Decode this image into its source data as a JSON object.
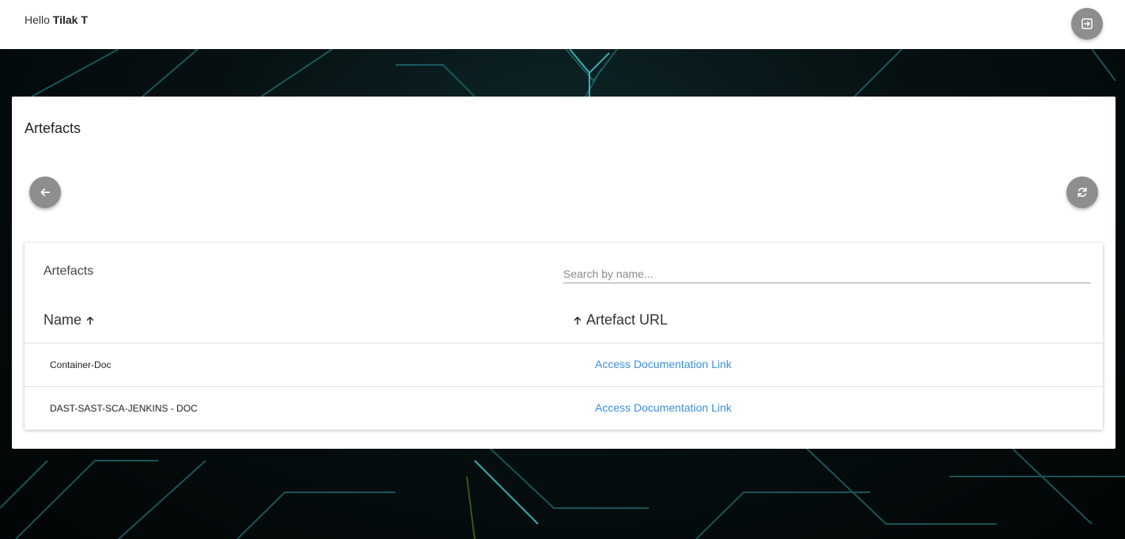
{
  "header": {
    "greeting_prefix": "Hello",
    "user_name": "Tilak T",
    "logout_icon": "logout-icon"
  },
  "main": {
    "title": "Artefacts",
    "back_icon": "arrow-left-icon",
    "refresh_icon": "refresh-icon"
  },
  "table": {
    "title": "Artefacts",
    "search_placeholder": "Search by name...",
    "columns": [
      {
        "label": "Name",
        "sort": "ascending"
      },
      {
        "label": "Artefact URL",
        "sort": "ascending"
      }
    ],
    "rows": [
      {
        "name": "Container-Doc",
        "link_label": "Access Documentation Link"
      },
      {
        "name": "DAST-SAST-SCA-JENKINS - DOC",
        "link_label": "Access Documentation Link"
      }
    ]
  },
  "colors": {
    "link": "#3a8fe0",
    "button_bg": "#8e8e8e",
    "background": "#050808"
  }
}
